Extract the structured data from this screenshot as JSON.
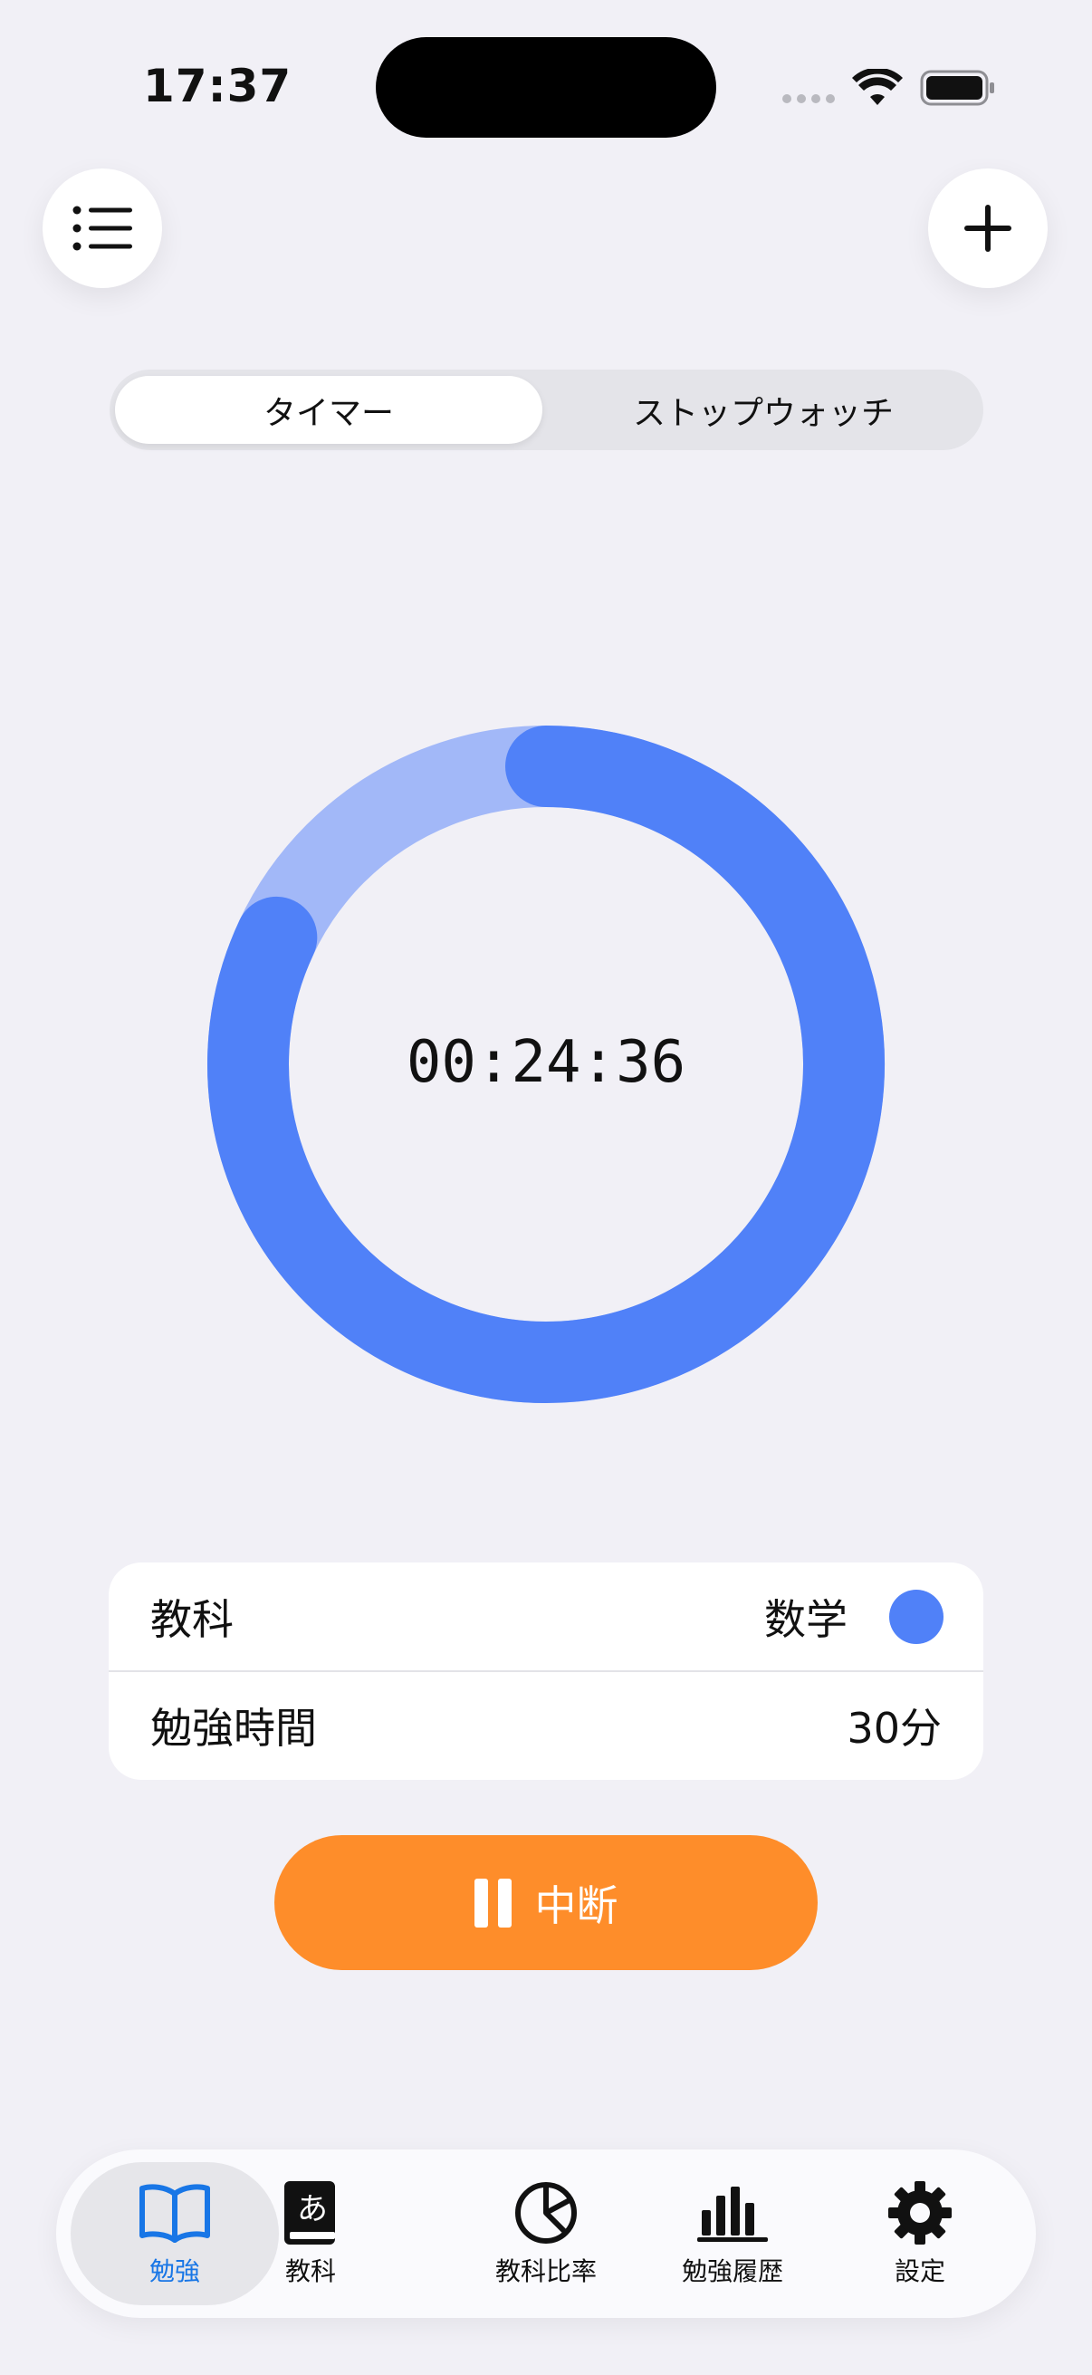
{
  "status_bar": {
    "time": "17:37"
  },
  "segmented": {
    "items": [
      "タイマー",
      "ストップウォッチ"
    ],
    "selected": "タイマー"
  },
  "timer": {
    "display": "00:24:36",
    "progress_fraction": 0.82,
    "ring_color": "#5081f8",
    "track_color": "#a2b8f8"
  },
  "info_card": {
    "subject_label": "教科",
    "subject_value": "数学",
    "subject_color": "#5081f8",
    "duration_label": "勉強時間",
    "duration_value": "30分"
  },
  "pause_button": {
    "label": "中断",
    "color": "#fe8d2a"
  },
  "tab_bar": {
    "active_color": "#1876e6",
    "items": [
      {
        "label": "勉強",
        "icon": "book-open-icon",
        "active": true
      },
      {
        "label": "教科",
        "icon": "book-closed-icon",
        "active": false
      },
      {
        "label": "教科比率",
        "icon": "pie-chart-icon",
        "active": false
      },
      {
        "label": "勉強履歴",
        "icon": "bar-chart-icon",
        "active": false
      },
      {
        "label": "設定",
        "icon": "gear-icon",
        "active": false
      }
    ]
  }
}
